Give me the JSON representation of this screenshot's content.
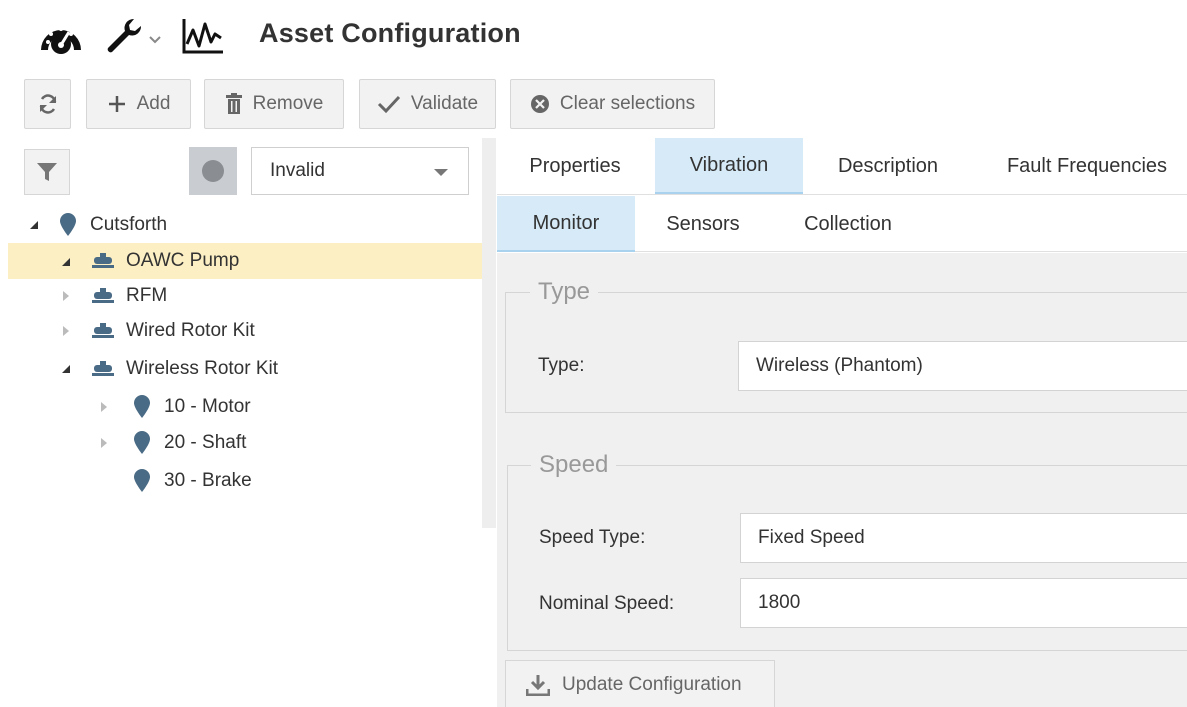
{
  "header": {
    "title": "Asset Configuration",
    "icons": [
      "dashboard-gauge-icon",
      "wrench-icon",
      "chevron-down-icon",
      "trend-chart-icon"
    ]
  },
  "toolbar": {
    "refresh_icon": "refresh-icon",
    "add_label": "Add",
    "remove_label": "Remove",
    "validate_label": "Validate",
    "clear_label": "Clear selections"
  },
  "filter": {
    "status_selected": "Invalid",
    "status_color": "#8a8d91"
  },
  "tree": {
    "items": [
      {
        "label": "Cutsforth",
        "level": 0,
        "expanded": true,
        "icon": "location-pin-icon"
      },
      {
        "label": "OAWC Pump",
        "level": 1,
        "expanded": true,
        "icon": "machine-icon",
        "selected": true
      },
      {
        "label": "RFM",
        "level": 1,
        "expanded": false,
        "icon": "machine-icon"
      },
      {
        "label": "Wired Rotor Kit",
        "level": 1,
        "expanded": false,
        "icon": "machine-icon"
      },
      {
        "label": "Wireless Rotor Kit",
        "level": 1,
        "expanded": true,
        "icon": "machine-icon"
      },
      {
        "label": "10 - Motor",
        "level": 2,
        "expanded": false,
        "icon": "location-pin-icon"
      },
      {
        "label": "20 - Shaft",
        "level": 2,
        "expanded": false,
        "icon": "location-pin-icon"
      },
      {
        "label": "30 - Brake",
        "level": 2,
        "icon": "location-pin-icon"
      }
    ]
  },
  "tabs": {
    "main": [
      "Properties",
      "Vibration",
      "Description",
      "Fault Frequencies"
    ],
    "main_active": "Vibration",
    "sub": [
      "Monitor",
      "Sensors",
      "Collection"
    ],
    "sub_active": "Monitor"
  },
  "type_section": {
    "legend": "Type",
    "type_label": "Type:",
    "type_value": "Wireless (Phantom)"
  },
  "speed_section": {
    "legend": "Speed",
    "speed_type_label": "Speed Type:",
    "speed_type_value": "Fixed Speed",
    "nominal_label": "Nominal Speed:",
    "nominal_value": "1800"
  },
  "actions": {
    "update_label": "Update Configuration"
  },
  "colors": {
    "selected_row": "#fcefc4",
    "active_tab": "#d6ebf7",
    "node_icon": "#4a6b85"
  }
}
